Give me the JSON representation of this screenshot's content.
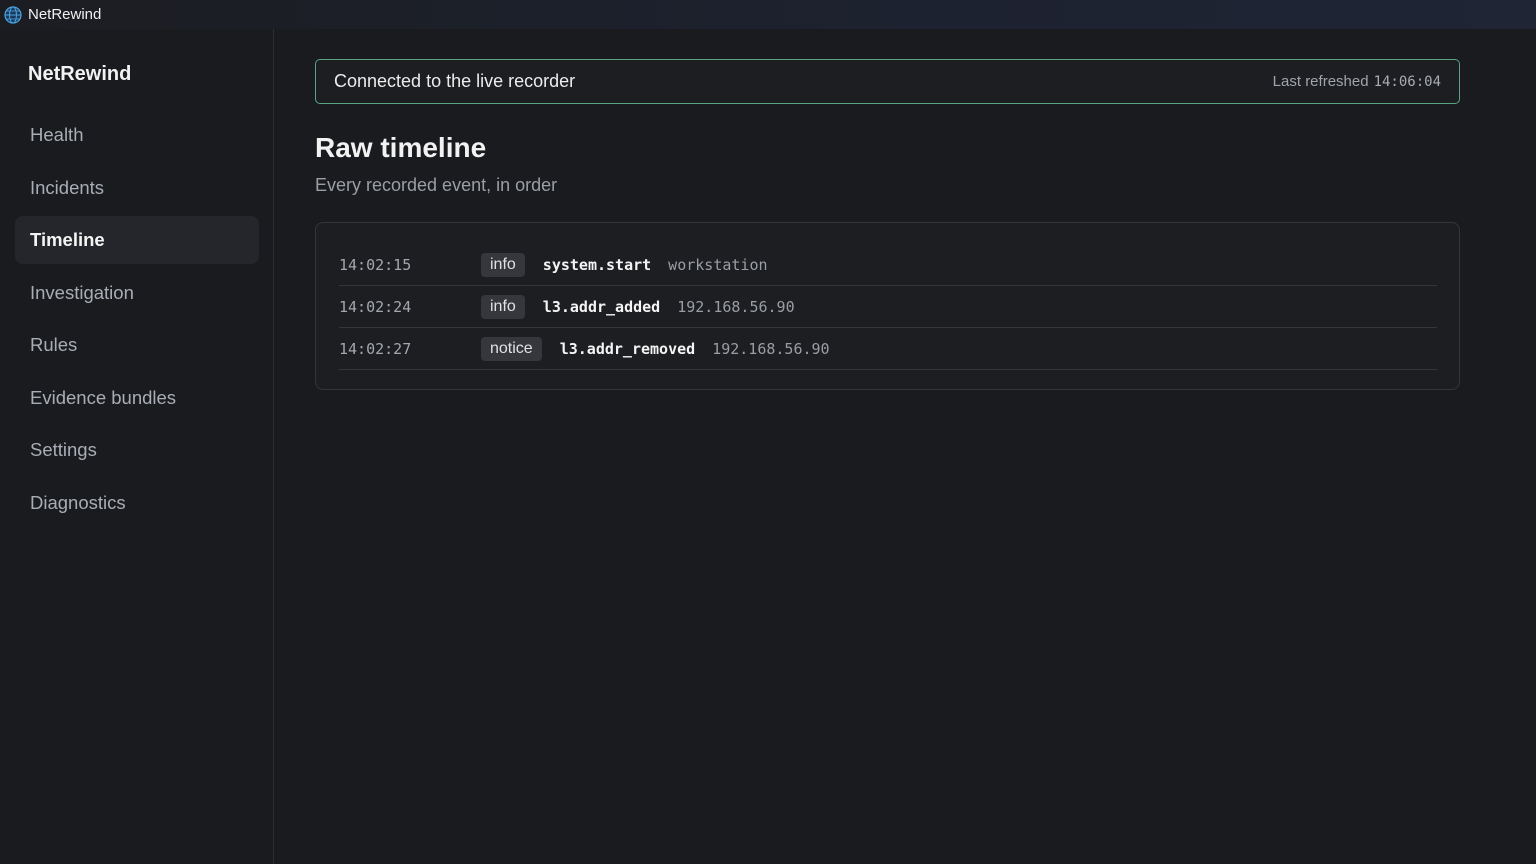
{
  "window": {
    "title": "NetRewind",
    "icon": "globe-icon"
  },
  "sidebar": {
    "brand": "NetRewind",
    "items": [
      {
        "label": "Health",
        "active": false
      },
      {
        "label": "Incidents",
        "active": false
      },
      {
        "label": "Timeline",
        "active": true
      },
      {
        "label": "Investigation",
        "active": false
      },
      {
        "label": "Rules",
        "active": false
      },
      {
        "label": "Evidence bundles",
        "active": false
      },
      {
        "label": "Settings",
        "active": false
      },
      {
        "label": "Diagnostics",
        "active": false
      }
    ]
  },
  "status": {
    "text": "Connected to the live recorder",
    "refresh_label": "Last refreshed",
    "refresh_time": "14:06:04",
    "border_color": "#5aa383"
  },
  "page": {
    "title": "Raw timeline",
    "subtitle": "Every recorded event, in order"
  },
  "timeline": {
    "events": [
      {
        "time": "14:02:15",
        "level": "info",
        "name": "system.start",
        "detail": "workstation"
      },
      {
        "time": "14:02:24",
        "level": "info",
        "name": "l3.addr_added",
        "detail": "192.168.56.90"
      },
      {
        "time": "14:02:27",
        "level": "notice",
        "name": "l3.addr_removed",
        "detail": "192.168.56.90"
      }
    ]
  }
}
